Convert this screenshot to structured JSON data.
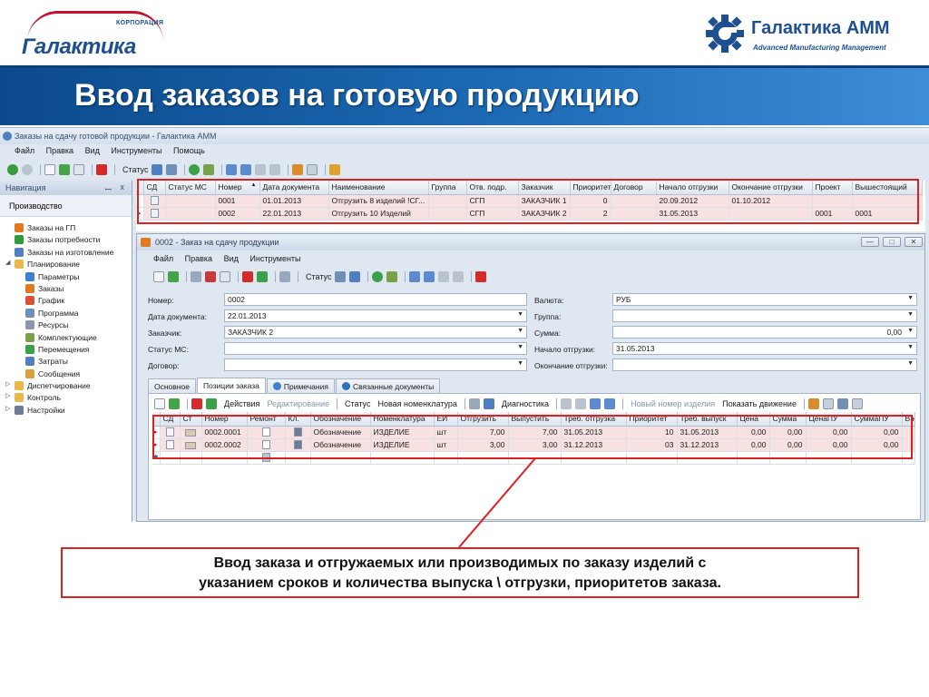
{
  "header": {
    "left_logo_small": "КОРПОРАЦИЯ",
    "left_logo": "Галактика",
    "right_logo": "Галактика АММ",
    "right_logo_sub": "Advanced Manufacturing Management",
    "slide_title": "Ввод заказов на готовую продукцию",
    "brand_colors": {
      "blue": "#1d4f91",
      "red": "#c8102e",
      "title_band": "#1d6bb5"
    }
  },
  "app": {
    "window_title": "Заказы на сдачу готовой продукции - Галактика АММ",
    "menu": [
      "Файл",
      "Правка",
      "Вид",
      "Инструменты",
      "Помощь"
    ],
    "toolbar_status": "Статус"
  },
  "nav": {
    "header": "Навигация",
    "pin": "ꟷ",
    "close": "x",
    "section": "Производство",
    "items": [
      {
        "label": "Заказы на ГП",
        "icon": "grid-icon",
        "indent": 1
      },
      {
        "label": "Заказы потребности",
        "icon": "dollar-icon",
        "indent": 1
      },
      {
        "label": "Заказы на изготовление",
        "icon": "doc-icon",
        "indent": 1
      },
      {
        "label": "Планирование",
        "icon": "folder-icon",
        "indent": 0,
        "expanded": true
      },
      {
        "label": "Параметры",
        "icon": "params-icon",
        "indent": 2
      },
      {
        "label": "Заказы",
        "icon": "grid-icon",
        "indent": 2
      },
      {
        "label": "График",
        "icon": "chart-icon",
        "indent": 2
      },
      {
        "label": "Программа",
        "icon": "program-icon",
        "indent": 2
      },
      {
        "label": "Ресурсы",
        "icon": "resources-icon",
        "indent": 2
      },
      {
        "label": "Комплектующие",
        "icon": "parts-icon",
        "indent": 2
      },
      {
        "label": "Перемещения",
        "icon": "move-icon",
        "indent": 2
      },
      {
        "label": "Затраты",
        "icon": "gear-icon",
        "indent": 2
      },
      {
        "label": "Сообщения",
        "icon": "mail-icon",
        "indent": 2
      },
      {
        "label": "Диспетчирование",
        "icon": "folder-icon",
        "indent": 0
      },
      {
        "label": "Контроль",
        "icon": "folder-icon",
        "indent": 0
      },
      {
        "label": "Настройки",
        "icon": "settings-icon",
        "indent": 0
      }
    ]
  },
  "orders_grid": {
    "columns": [
      "СД",
      "Статус МС",
      "Номер",
      "Дата документа",
      "Наименование",
      "Группа",
      "Отв. подр.",
      "Заказчик",
      "Приоритет",
      "Договор",
      "Начало отгрузки",
      "Окончание отгрузки",
      "Проект",
      "Вышестоящий"
    ],
    "sort_marker": "▲",
    "rows": [
      {
        "marker": "",
        "sd": "",
        "status": "",
        "number": "0001",
        "date": "01.01.2013",
        "name": "Отгрузить 8 изделий !СГ...",
        "group": "",
        "dept": "СГП",
        "customer": "ЗАКАЗЧИК 1",
        "priority": "0",
        "contract": "",
        "start": "20.09.2012",
        "end": "01.10.2012",
        "project": "",
        "parent": ""
      },
      {
        "marker": "▸",
        "sd": "",
        "status": "",
        "number": "0002",
        "date": "22.01.2013",
        "name": "Отгрузить 10 Изделий",
        "group": "",
        "dept": "СГП",
        "customer": "ЗАКАЗЧИК 2",
        "priority": "2",
        "contract": "",
        "start": "31.05.2013",
        "end": "",
        "project": "0001",
        "parent": "0001"
      }
    ]
  },
  "doc": {
    "title": "0002 - Заказ на сдачу продукции",
    "win_min": "—",
    "win_max": "□",
    "win_close": "✕",
    "menu": [
      "Файл",
      "Правка",
      "Вид",
      "Инструменты"
    ],
    "toolbar_status": "Статус",
    "form": {
      "number_label": "Номер:",
      "number_value": "0002",
      "date_label": "Дата документа:",
      "date_value": "22.01.2013",
      "customer_label": "Заказчик:",
      "customer_value": "ЗАКАЗЧИК 2",
      "ms_status_label": "Статус МС:",
      "ms_status_value": "",
      "contract_label": "Договор:",
      "contract_value": "",
      "currency_label": "Валюта:",
      "currency_value": "РУБ",
      "group_label": "Группа:",
      "group_value": "",
      "sum_label": "Сумма:",
      "sum_value": "0,00",
      "ship_start_label": "Начало отгрузки:",
      "ship_start_value": "31.05.2013",
      "ship_end_label": "Окончание отгрузки:",
      "ship_end_value": ""
    },
    "tabs": [
      {
        "label": "Основное",
        "active": false,
        "icon": ""
      },
      {
        "label": "Позиции заказа",
        "active": true,
        "icon": ""
      },
      {
        "label": "Примечания",
        "active": false,
        "icon": "note-icon"
      },
      {
        "label": "Связанные документы",
        "active": false,
        "icon": "link-icon"
      }
    ],
    "positions_toolbar": {
      "actions": "Действия",
      "edit": "Редактирование",
      "status": "Статус",
      "new_item": "Новая номенклатура",
      "diagnostics": "Диагностика",
      "new_number": "Новый номер изделия",
      "show_movement": "Показать движение"
    },
    "positions_grid": {
      "columns": [
        "СД",
        "Ст",
        "Номер",
        "Ремонт",
        "Кл.",
        "Обозначение",
        "Номенклатура",
        "ЕИ",
        "Отгрузить",
        "Выпустить",
        "Треб. отгрузка",
        "Приоритет",
        "Треб. выпуск",
        "Цена",
        "Сумма",
        "ЦенаПУ",
        "СуммаПУ",
        "В н"
      ],
      "rows": [
        {
          "marker": "▸",
          "number": "0002.0001",
          "designation": "Обозначение",
          "item": "ИЗДЕЛИЕ",
          "unit": "шт",
          "ship": "7,00",
          "release": "7,00",
          "req_ship": "31.05.2013",
          "priority": "10",
          "req_release": "31.05.2013",
          "price": "0,00",
          "sum": "0,00",
          "price_pu": "0,00",
          "sum_pu": "0,00"
        },
        {
          "marker": "▸",
          "number": "0002.0002",
          "designation": "Обозначение",
          "item": "ИЗДЕЛИЕ",
          "unit": "шт",
          "ship": "3,00",
          "release": "3,00",
          "req_ship": "31.12.2013",
          "priority": "03",
          "req_release": "31.12.2013",
          "price": "0,00",
          "sum": "0,00",
          "price_pu": "0,00",
          "sum_pu": "0,00"
        }
      ],
      "new_row_marker": "✱"
    }
  },
  "callout": {
    "line1": "Ввод заказа и отгружаемых или производимых по заказу изделий с",
    "line2": "указанием сроков  и количества выпуска \\ отгрузки, приоритетов заказа.",
    "frame_color": "#e02020"
  }
}
